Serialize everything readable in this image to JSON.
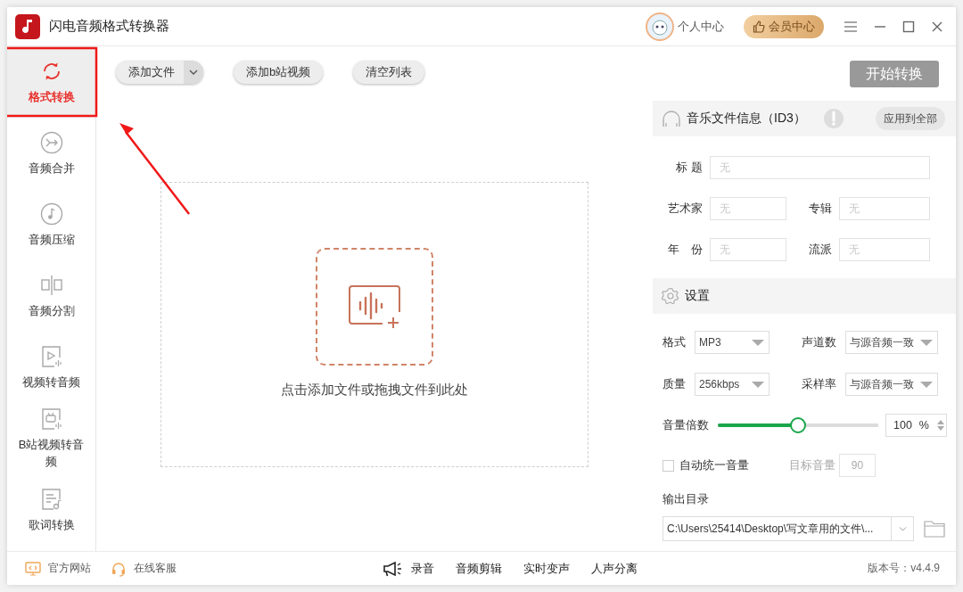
{
  "window": {
    "title": "闪电音频格式转换器"
  },
  "header": {
    "user_label": "个人中心",
    "vip_label": "会员中心"
  },
  "sidebar": {
    "items": [
      {
        "label": "格式转换",
        "kind": "convert",
        "selected": true
      },
      {
        "label": "音频合并",
        "kind": "merge",
        "selected": false
      },
      {
        "label": "音频压缩",
        "kind": "compress",
        "selected": false
      },
      {
        "label": "音频分割",
        "kind": "split",
        "selected": false
      },
      {
        "label": "视频转音频",
        "kind": "video",
        "selected": false
      },
      {
        "label": "B站视频转音频",
        "kind": "bilibili",
        "selected": false
      },
      {
        "label": "歌词转换",
        "kind": "lyrics",
        "selected": false
      }
    ]
  },
  "annotation": {
    "kind": "box-and-arrow"
  },
  "toolbar": {
    "buttons": [
      {
        "label": "添加文件",
        "kind": "dropdown"
      },
      {
        "label": "添加b站视频",
        "kind": "plain"
      },
      {
        "label": "清空列表",
        "kind": "plain"
      }
    ]
  },
  "dropzone": {
    "hint": "点击添加文件或拖拽文件到此处"
  },
  "start_button": "开始转换",
  "id3": {
    "title": "音乐文件信息（ID3）",
    "apply_all": "应用到全部",
    "fields": [
      {
        "label": "标 题",
        "placeholder": "无",
        "kind": "wide"
      },
      {
        "label": "艺术家",
        "placeholder": "无",
        "kind": "left"
      },
      {
        "label": "专辑",
        "placeholder": "无",
        "kind": "right"
      },
      {
        "label": "年　份",
        "placeholder": "无",
        "kind": "left"
      },
      {
        "label": "流派",
        "placeholder": "无",
        "kind": "right"
      }
    ]
  },
  "settings": {
    "title": "设置",
    "selects": [
      {
        "label": "格式",
        "value": "MP3"
      },
      {
        "label": "声道数",
        "value": "与源音频一致"
      },
      {
        "label": "质量",
        "value": "256kbps"
      },
      {
        "label": "采样率",
        "value": "与源音频一致"
      }
    ],
    "volume": {
      "label": "音量倍数",
      "level": 0.5,
      "value": "100",
      "unit": "%"
    },
    "auto_volume": {
      "label": "自动统一音量",
      "checked": false,
      "target_label": "目标音量",
      "target_value": "90"
    },
    "output": {
      "label": "输出目录",
      "path": "C:\\Users\\25414\\Desktop\\写文章用的文件\\..."
    }
  },
  "footer": {
    "links": [
      {
        "label": "官方网站",
        "kind": "monitor"
      },
      {
        "label": "在线客服",
        "kind": "headset"
      }
    ],
    "tools": [
      "录音",
      "音频剪辑",
      "实时变声",
      "人声分离"
    ],
    "version": "版本号：v4.4.9"
  }
}
